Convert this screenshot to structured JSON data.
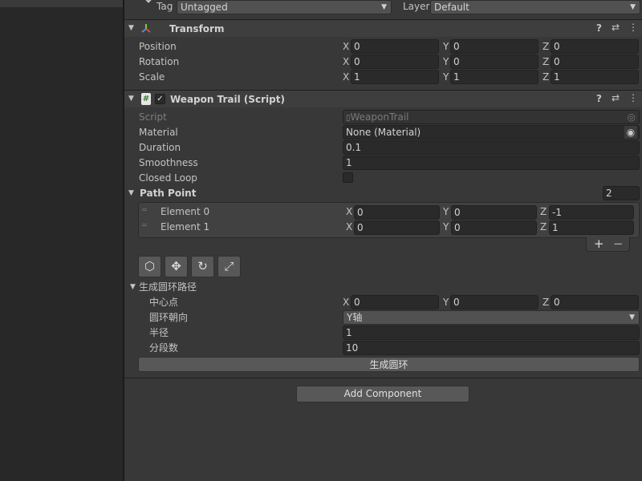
{
  "header": {
    "tag_label": "Tag",
    "tag_value": "Untagged",
    "layer_label": "Layer",
    "layer_value": "Default"
  },
  "transform": {
    "title": "Transform",
    "rows": [
      {
        "label": "Position",
        "x": "0",
        "y": "0",
        "z": "0"
      },
      {
        "label": "Rotation",
        "x": "0",
        "y": "0",
        "z": "0"
      },
      {
        "label": "Scale",
        "x": "1",
        "y": "1",
        "z": "1"
      }
    ]
  },
  "axes": {
    "x": "X",
    "y": "Y",
    "z": "Z"
  },
  "weapon_trail": {
    "title": "Weapon Trail (Script)",
    "script_label": "Script",
    "script_value": "WeaponTrail",
    "material_label": "Material",
    "material_value": "None (Material)",
    "duration_label": "Duration",
    "duration_value": "0.1",
    "smoothness_label": "Smoothness",
    "smoothness_value": "1",
    "closed_loop_label": "Closed Loop",
    "path_point_label": "Path Point",
    "path_point_count": "2",
    "elements": [
      {
        "label": "Element 0",
        "x": "0",
        "y": "0",
        "z": "-1"
      },
      {
        "label": "Element 1",
        "x": "0",
        "y": "0",
        "z": "1"
      }
    ],
    "add_symbol": "+",
    "remove_symbol": "−"
  },
  "ring": {
    "section_label": "生成圆环路径",
    "center_label": "中心点",
    "center_x": "0",
    "center_y": "0",
    "center_z": "0",
    "orientation_label": "圆环朝向",
    "orientation_value": "Y轴",
    "radius_label": "半径",
    "radius_value": "1",
    "segments_label": "分段数",
    "segments_value": "10",
    "generate_button": "生成圆环"
  },
  "add_component_button": "Add Component",
  "colors": {
    "background": "#383838",
    "field": "#2a2a2a",
    "button": "#585858"
  }
}
